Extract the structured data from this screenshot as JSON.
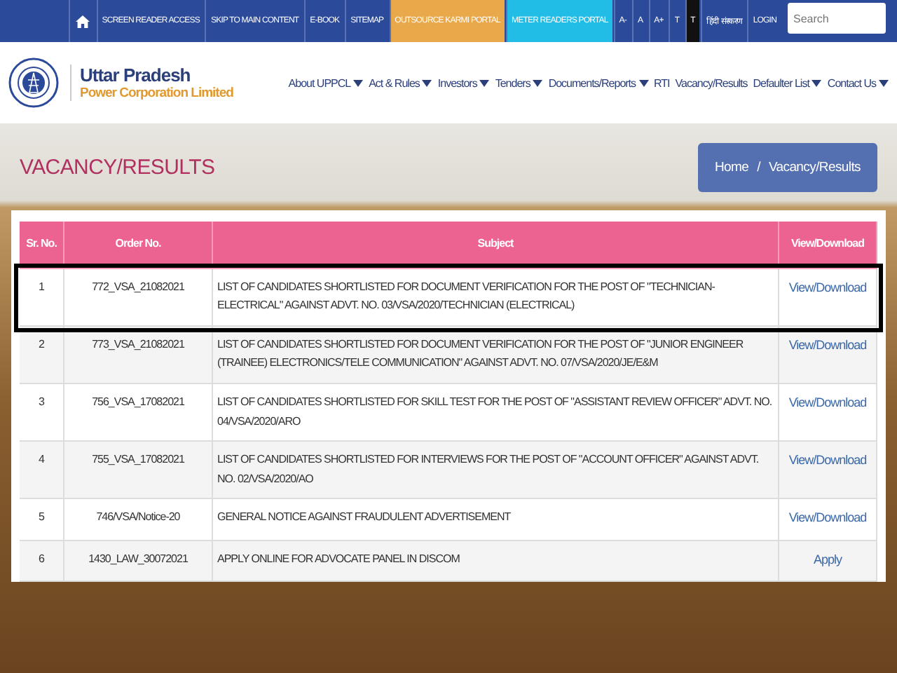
{
  "top_bar": {
    "links": [
      {
        "kind": "home",
        "color": "#2b4a9a"
      },
      {
        "kind": "link",
        "label": "SCREEN READER ACCESS",
        "color": "#2b4a9a"
      },
      {
        "kind": "link",
        "label": "SKIP TO MAIN CONTENT",
        "color": "#2b4a9a"
      },
      {
        "kind": "link",
        "label": "E-BOOK",
        "color": "#2b4a9a"
      },
      {
        "kind": "link",
        "label": "SITEMAP",
        "color": "#2b4a9a"
      },
      {
        "kind": "link",
        "label": "OUTSOURCE KARMI PORTAL",
        "color": "#e9a84a"
      },
      {
        "kind": "link",
        "label": "METER READERS PORTAL",
        "color": "#22bde6"
      },
      {
        "kind": "link",
        "label": "A-",
        "color": "#2b4a9a"
      },
      {
        "kind": "link",
        "label": "A",
        "color": "#2b4a9a"
      },
      {
        "kind": "link",
        "label": "A+",
        "color": "#2b4a9a"
      },
      {
        "kind": "link",
        "label": "T",
        "color": "#2b4a9a"
      },
      {
        "kind": "link",
        "label": "T",
        "color": "#111111"
      },
      {
        "kind": "link",
        "label": "हिंदी संस्करण",
        "color": "#2b4a9a"
      },
      {
        "kind": "link",
        "label": "LOGIN",
        "color": "#2b4a9a"
      }
    ],
    "search": {
      "placeholder": "Search"
    }
  },
  "brand": {
    "name": "Uttar Pradesh",
    "subtitle": "Power Corporation Limited"
  },
  "nav": [
    {
      "label": "About UPPCL",
      "dropdown": true
    },
    {
      "label": "Act & Rules",
      "dropdown": true
    },
    {
      "label": "Investors",
      "dropdown": true
    },
    {
      "label": "Tenders",
      "dropdown": true
    },
    {
      "label": "Documents/Reports",
      "dropdown": true
    },
    {
      "label": "RTI",
      "dropdown": false
    },
    {
      "label": "Vacancy/Results",
      "dropdown": false
    },
    {
      "label": "Defaulter List",
      "dropdown": true
    },
    {
      "label": "Contact Us",
      "dropdown": true
    }
  ],
  "page_title": "VACANCY/RESULTS",
  "breadcrumb": {
    "separator": "/",
    "items": [
      "Home",
      "Vacancy/Results"
    ]
  },
  "table": {
    "columns": [
      "Sr. No.",
      "Order No.",
      "Subject",
      "View/Download"
    ],
    "rows": [
      {
        "sr": "1",
        "order": "772_VSA_21082021",
        "subject": "LIST OF CANDIDATES  SHORTLISTED FOR DOCUMENT VERIFICATION FOR THE POST OF \"TECHNICIAN-ELECTRICAL\" AGAINST ADVT. NO. 03/VSA/2020/TECHNICIAN (ELECTRICAL)",
        "link": "View/Download",
        "highlighted": true
      },
      {
        "sr": "2",
        "order": "773_VSA_21082021",
        "subject": "LIST OF CANDIDATES  SHORTLISTED FOR DOCUMENT VERIFICATION FOR THE POST OF \"JUNIOR ENGINEER (TRAINEE) ELECTRONICS/TELE COMMUNICATION\" AGAINST ADVT. NO. 07/VSA/2020/JE/E&M",
        "link": "View/Download",
        "highlighted": false
      },
      {
        "sr": "3",
        "order": "756_VSA_17082021",
        "subject": "LIST OF CANDIDATES  SHORTLISTED FOR SKILL TEST FOR THE POST OF \"ASSISTANT REVIEW OFFICER\" ADVT. NO. 04/VSA/2020/ARO",
        "link": "View/Download",
        "highlighted": false
      },
      {
        "sr": "4",
        "order": "755_VSA_17082021",
        "subject": "LIST OF CANDIDATES  SHORTLISTED FOR INTERVIEWS FOR THE POST OF  \"ACCOUNT OFFICER\" AGAINST ADVT. NO. 02/VSA/2020/AO",
        "link": "View/Download",
        "highlighted": false
      },
      {
        "sr": "5",
        "order": "746/VSA/Notice-20",
        "subject": "GENERAL NOTICE AGAINST FRAUDULENT ADVERTISEMENT",
        "link": "View/Download",
        "highlighted": false
      },
      {
        "sr": "6",
        "order": "1430_LAW_30072021",
        "subject": "APPLY ONLINE FOR ADVOCATE PANEL IN  DISCOM",
        "link": "Apply",
        "highlighted": false
      }
    ]
  }
}
